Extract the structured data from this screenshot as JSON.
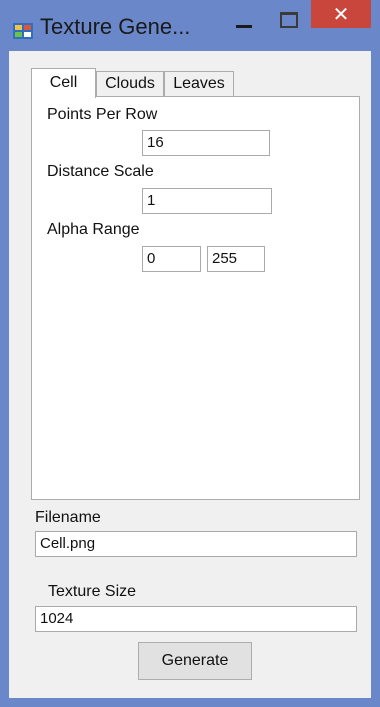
{
  "window": {
    "title": "Texture Gene...",
    "close_glyph": "✕",
    "colors": {
      "frame": "#6a87c9",
      "close": "#c9463d",
      "client": "#f0f0f0"
    }
  },
  "tabs": [
    {
      "label": "Cell",
      "selected": true
    },
    {
      "label": "Clouds",
      "selected": false
    },
    {
      "label": "Leaves",
      "selected": false
    }
  ],
  "cell_tab": {
    "points_per_row": {
      "label": "Points Per Row",
      "value": "16"
    },
    "distance_scale": {
      "label": "Distance Scale",
      "value": "1"
    },
    "alpha_range": {
      "label": "Alpha Range",
      "min": "0",
      "max": "255"
    }
  },
  "filename": {
    "label": "Filename",
    "value": "Cell.png"
  },
  "texture_size": {
    "label": "Texture Size",
    "value": "1024"
  },
  "generate_label": "Generate",
  "icons": [
    "app-icon",
    "minimize-icon",
    "maximize-icon",
    "close-icon"
  ]
}
